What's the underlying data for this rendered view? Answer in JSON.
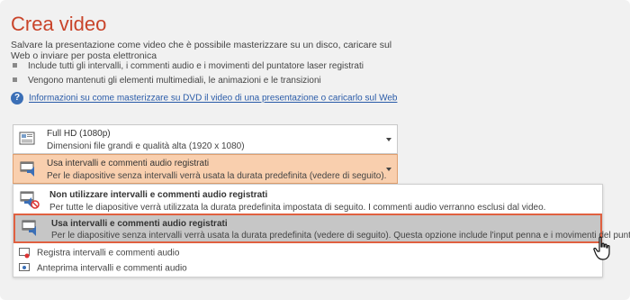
{
  "header": {
    "title": "Crea video",
    "description": "Salvare la presentazione come video che è possibile masterizzare su un disco, caricare sul Web o inviare per posta elettronica",
    "bullets": [
      "Include tutti gli intervalli, i commenti audio e i movimenti del puntatore laser registrati",
      "Vengono mantenuti gli elementi multimediali, le animazioni e le transizioni"
    ],
    "help_link": "Informazioni su come masterizzare su DVD il video di una presentazione o caricarlo sul Web"
  },
  "quality_dropdown": {
    "title": "Full HD (1080p)",
    "subtitle": "Dimensioni file grandi e qualità alta (1920 x 1080)"
  },
  "timing_dropdown": {
    "title": "Usa intervalli e commenti audio registrati",
    "subtitle": "Per le diapositive senza intervalli verrà usata la durata predefinita (vedere di seguito). Questa op..."
  },
  "menu": {
    "items": [
      {
        "title": "Non utilizzare intervalli e commenti audio registrati",
        "subtitle": "Per tutte le diapositive verrà utilizzata la durata predefinita impostata di seguito. I commenti audio verranno esclusi dal video."
      },
      {
        "title": "Usa intervalli e commenti audio registrati",
        "subtitle": "Per le diapositive senza intervalli verrà usata la durata predefinita (vedere di seguito). Questa opzione include l'input penna e i movimenti del puntatore laser."
      }
    ],
    "actions": [
      "Registra intervalli e commenti audio",
      "Anteprima intervalli e commenti audio"
    ]
  },
  "colors": {
    "accent": "#c9442a",
    "selected_border": "#e06040",
    "link": "#2a5ba8"
  }
}
